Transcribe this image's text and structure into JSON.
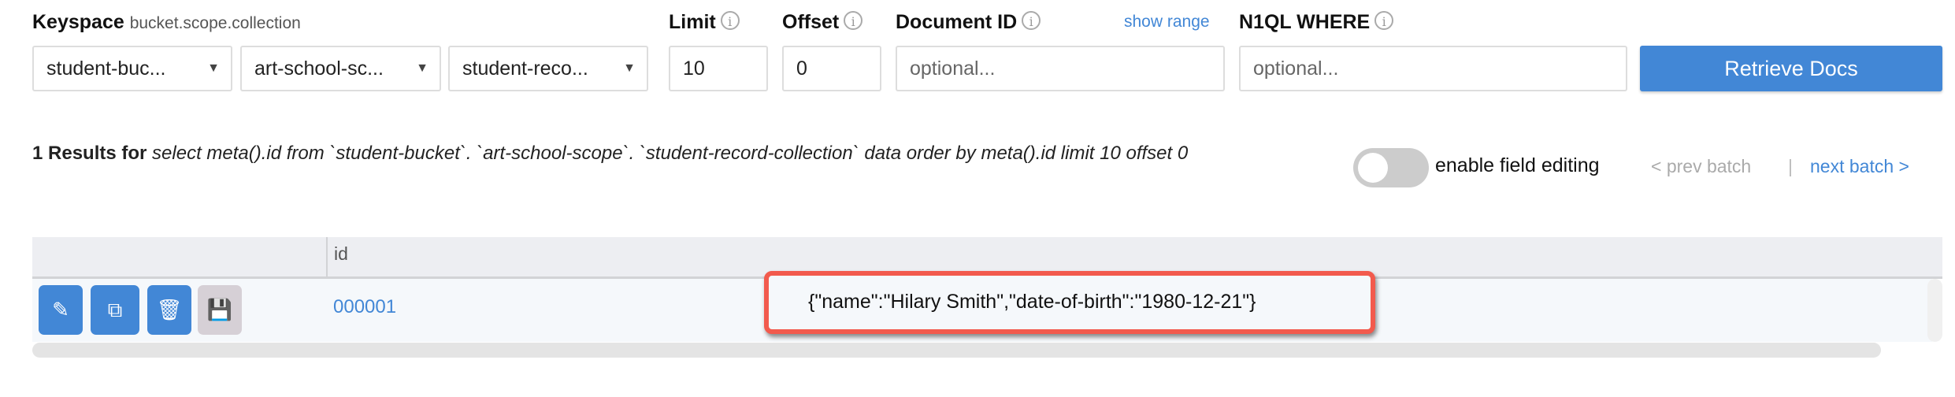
{
  "form": {
    "keyspace_label": "Keyspace",
    "keyspace_hint": "bucket.scope.collection",
    "bucket": "student-buc...",
    "scope": "art-school-sc...",
    "collection": "student-reco...",
    "limit_label": "Limit",
    "limit_value": "10",
    "offset_label": "Offset",
    "offset_value": "0",
    "docid_label": "Document ID",
    "docid_placeholder": "optional...",
    "show_range": "show range",
    "where_label": "N1QL WHERE",
    "where_placeholder": "optional...",
    "retrieve_button": "Retrieve Docs",
    "info_glyph": "i"
  },
  "results": {
    "count_text": "1 Results for",
    "query": "select meta().id from `student-bucket`. `art-school-scope`. `student-record-collection` data order by meta().id limit 10 offset 0",
    "enable_editing_label": "enable field editing",
    "enable_editing_on": false,
    "prev_batch": "< prev batch",
    "separator": "|",
    "next_batch": "next batch >"
  },
  "table": {
    "columns": [
      "",
      "id"
    ],
    "rows": [
      {
        "id": "000001",
        "doc": "{\"name\":\"Hilary Smith\",\"date-of-birth\":\"1980-12-21\"}"
      }
    ],
    "icons": {
      "edit": "pencil-icon",
      "copy": "copy-icon",
      "delete": "trash-icon",
      "save": "save-icon"
    }
  },
  "colors": {
    "accent": "#4287d6",
    "highlight": "#f25a4d"
  }
}
